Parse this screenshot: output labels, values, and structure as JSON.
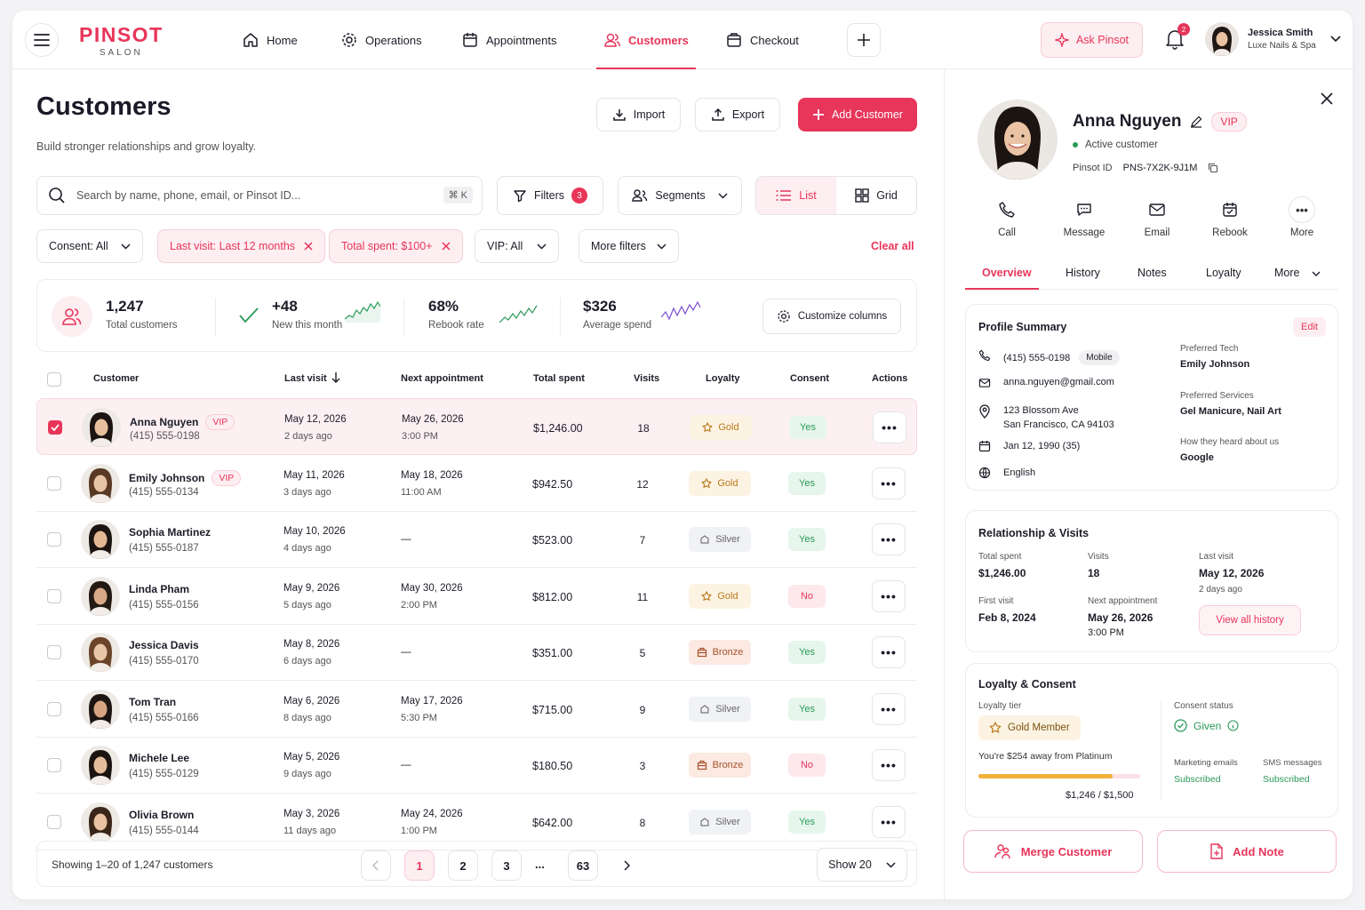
{
  "brand": {
    "name": "PINSOT",
    "sub": "SALON"
  },
  "nav": [
    {
      "label": "Home",
      "icon": "home-icon"
    },
    {
      "label": "Operations",
      "icon": "gear-icon"
    },
    {
      "label": "Appointments",
      "icon": "calendar-icon"
    },
    {
      "label": "Customers",
      "icon": "users-icon",
      "active": true
    },
    {
      "label": "Checkout",
      "icon": "register-icon"
    }
  ],
  "topbar": {
    "ask_label": "Ask Pinsot",
    "notifications": "2",
    "user_name": "Jessica Smith",
    "user_business": "Luxe Nails & Spa"
  },
  "page": {
    "title": "Customers",
    "subtitle": "Build stronger relationships and grow loyalty.",
    "import_label": "Import",
    "export_label": "Export",
    "add_label": "Add Customer"
  },
  "search": {
    "placeholder": "Search by name, phone, email, or Pinsot ID...",
    "shortcut": "⌘ K"
  },
  "toolbar": {
    "filters_label": "Filters",
    "filters_count": "3",
    "segments_label": "Segments",
    "list_label": "List",
    "grid_label": "Grid"
  },
  "chips": {
    "consent": "Consent: All",
    "last_visit": "Last visit: Last 12 months",
    "total_spent": "Total spent: $100+",
    "vip": "VIP: All",
    "more": "More filters",
    "clear": "Clear all"
  },
  "stats": {
    "total_value": "1,247",
    "total_label": "Total customers",
    "new_value": "+48",
    "new_label": "New this month",
    "rebook_value": "68%",
    "rebook_label": "Rebook rate",
    "spend_value": "$326",
    "spend_label": "Average spend",
    "customize_label": "Customize columns"
  },
  "columns": [
    "Customer",
    "Last visit",
    "Next appointment",
    "Total spent",
    "Visits",
    "Loyalty",
    "Consent",
    "Actions"
  ],
  "customers": [
    {
      "name": "Anna Nguyen",
      "vip": "VIP",
      "phone": "(415) 555-0198",
      "last": "May 12, 2026",
      "ago": "2 days ago",
      "next": "May 26, 2026",
      "next_time": "3:00 PM",
      "spent": "$1,246.00",
      "visits": "18",
      "tier": "Gold",
      "consent": "Yes",
      "selected": true
    },
    {
      "name": "Emily Johnson",
      "vip": "VIP",
      "phone": "(415) 555-0134",
      "last": "May 11, 2026",
      "ago": "3 days ago",
      "next": "May 18, 2026",
      "next_time": "11:00 AM",
      "spent": "$942.50",
      "visits": "12",
      "tier": "Gold",
      "consent": "Yes"
    },
    {
      "name": "Sophia Martinez",
      "vip": "",
      "phone": "(415) 555-0187",
      "last": "May 10, 2026",
      "ago": "4 days ago",
      "next": "—",
      "next_time": "",
      "spent": "$523.00",
      "visits": "7",
      "tier": "Silver",
      "consent": "Yes"
    },
    {
      "name": "Linda Pham",
      "vip": "",
      "phone": "(415) 555-0156",
      "last": "May 9, 2026",
      "ago": "5 days ago",
      "next": "May 30, 2026",
      "next_time": "2:00 PM",
      "spent": "$812.00",
      "visits": "11",
      "tier": "Gold",
      "consent": "No"
    },
    {
      "name": "Jessica Davis",
      "vip": "",
      "phone": "(415) 555-0170",
      "last": "May 8, 2026",
      "ago": "6 days ago",
      "next": "—",
      "next_time": "",
      "spent": "$351.00",
      "visits": "5",
      "tier": "Bronze",
      "consent": "Yes"
    },
    {
      "name": "Tom Tran",
      "vip": "",
      "phone": "(415) 555-0166",
      "last": "May 6, 2026",
      "ago": "8 days ago",
      "next": "May 17, 2026",
      "next_time": "5:30 PM",
      "spent": "$715.00",
      "visits": "9",
      "tier": "Silver",
      "consent": "Yes"
    },
    {
      "name": "Michele Lee",
      "vip": "",
      "phone": "(415) 555-0129",
      "last": "May 5, 2026",
      "ago": "9 days ago",
      "next": "—",
      "next_time": "",
      "spent": "$180.50",
      "visits": "3",
      "tier": "Bronze",
      "consent": "No"
    },
    {
      "name": "Olivia Brown",
      "vip": "",
      "phone": "(415) 555-0144",
      "last": "May 3, 2026",
      "ago": "11 days ago",
      "next": "May 24, 2026",
      "next_time": "1:00 PM",
      "spent": "$642.00",
      "visits": "8",
      "tier": "Silver",
      "consent": "Yes"
    }
  ],
  "pagination": {
    "summary": "Showing 1–20 of 1,247 customers",
    "pages": [
      "1",
      "2",
      "3",
      "...",
      "63"
    ],
    "show_label": "Show 20"
  },
  "profile": {
    "name": "Anna Nguyen",
    "vip": "VIP",
    "status": "Active customer",
    "id_label": "Pinsot ID",
    "id": "PNS-7X2K-9J1M",
    "actions": [
      "Call",
      "Message",
      "Email",
      "Rebook",
      "More"
    ],
    "tabs": [
      "Overview",
      "History",
      "Notes",
      "Loyalty",
      "More"
    ],
    "summary_title": "Profile Summary",
    "edit_label": "Edit",
    "phone": "(415) 555-0198",
    "phone_type": "Mobile",
    "email": "anna.nguyen@gmail.com",
    "address1": "123 Blossom Ave",
    "address2": "San Francisco, CA 94103",
    "birthday": "Jan 12, 1990 (35)",
    "language": "English",
    "tech_label": "Preferred Tech",
    "tech": "Emily Johnson",
    "services_label": "Preferred Services",
    "services": "Gel Manicure, Nail Art",
    "heard_label": "How they heard about us",
    "heard": "Google",
    "rel_title": "Relationship & Visits",
    "spent_label": "Total spent",
    "spent": "$1,246.00",
    "visits_label": "Visits",
    "visits": "18",
    "last_label": "Last visit",
    "last": "May 12, 2026",
    "last_ago": "2 days ago",
    "first_label": "First visit",
    "first": "Feb 8, 2024",
    "next_label": "Next appointment",
    "next": "May 26, 2026",
    "next_time": "3:00 PM",
    "history_label": "View all history",
    "loy_title": "Loyalty & Consent",
    "tier_label": "Loyalty tier",
    "tier": "Gold Member",
    "away": "You're $254 away from Platinum",
    "progress": 0.83,
    "progress_text": "$1,246 / $1,500",
    "consent_label": "Consent status",
    "consent": "Given",
    "mkt_label": "Marketing emails",
    "mkt": "Subscribed",
    "sms_label": "SMS messages",
    "sms": "Subscribed",
    "merge_label": "Merge Customer",
    "note_label": "Add Note"
  },
  "colors": {
    "accent": "#e8355a",
    "gold": "#b8791c",
    "green": "#2b9a5a"
  }
}
